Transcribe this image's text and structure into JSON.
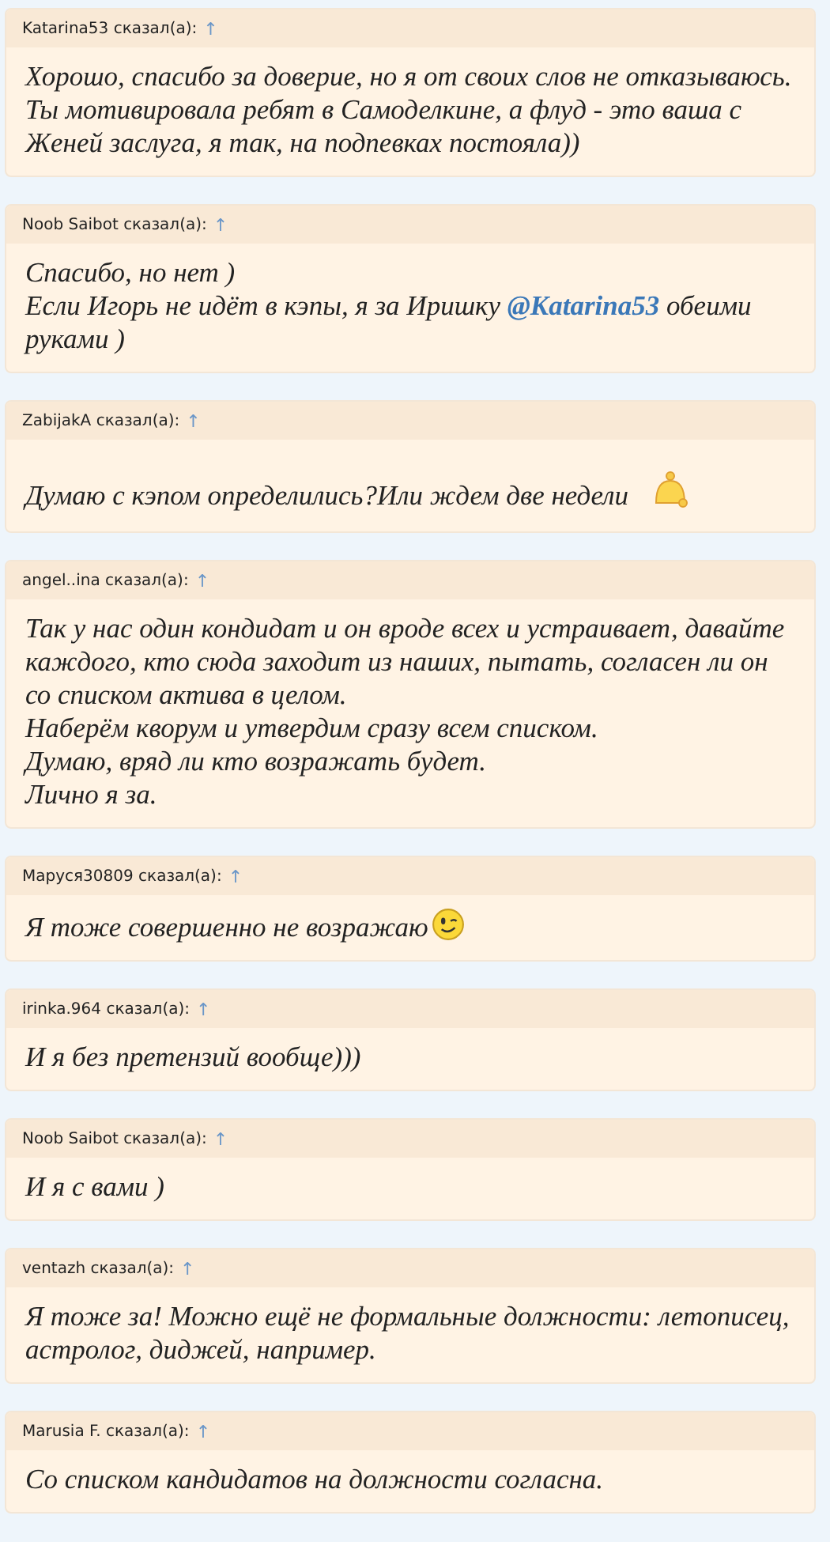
{
  "quotes": [
    {
      "author": "Katarina53 сказал(а):",
      "arrow": "↑",
      "lines": [
        "Хорошо, спасибо за доверие, но я от своих слов не отказываюсь. Ты мотивировала ребят в Самоделкине, а флуд - это ваша с Женей заслуга, я так, на подпевках постояла))"
      ]
    },
    {
      "author": "Noob Saibot сказал(а):",
      "arrow": "↑",
      "lines": [
        "Спасибо, но нет )",
        [
          {
            "text": "Если Игорь не идёт в кэпы, я за Иришку "
          },
          {
            "text": "@Katarina53",
            "kind": "mention"
          },
          {
            "text": " обеими руками )"
          }
        ]
      ]
    },
    {
      "author": "ZabijakA сказал(а):",
      "arrow": "↑",
      "lines": [
        "Думаю с кэпом определились?Или ждем две недели"
      ],
      "emoji": {
        "kind": "bell"
      }
    },
    {
      "author": "angel..ina сказал(а):",
      "arrow": "↑",
      "lines": [
        "Так у нас один кондидат и он вроде всех и устраивает, давайте каждого, кто сюда заходит из наших, пытать, согласен ли он со списком актива в целом.",
        "Наберём кворум и утвердим сразу всем списком.",
        "Думаю, вряд ли кто возражать будет.",
        "Лично я за."
      ]
    },
    {
      "author": "Маруся30809 сказал(а):",
      "arrow": "↑",
      "lines": [
        "Я тоже совершенно не возражаю"
      ],
      "emoji": {
        "kind": "wink"
      }
    },
    {
      "author": "irinka.964 сказал(а):",
      "arrow": "↑",
      "lines": [
        "И я без претензий вообще)))"
      ]
    },
    {
      "author": "Noob Saibot сказал(а):",
      "arrow": "↑",
      "lines": [
        "И я с вами )"
      ]
    },
    {
      "author": "ventazh сказал(а):",
      "arrow": "↑",
      "lines": [
        "Я тоже за! Можно ещё не формальные должности: летописец, астролог, диджей, например."
      ]
    },
    {
      "author": "Marusia F. сказал(а):",
      "arrow": "↑",
      "lines": [
        "Со списком кандидатов на должности согласна."
      ]
    }
  ]
}
